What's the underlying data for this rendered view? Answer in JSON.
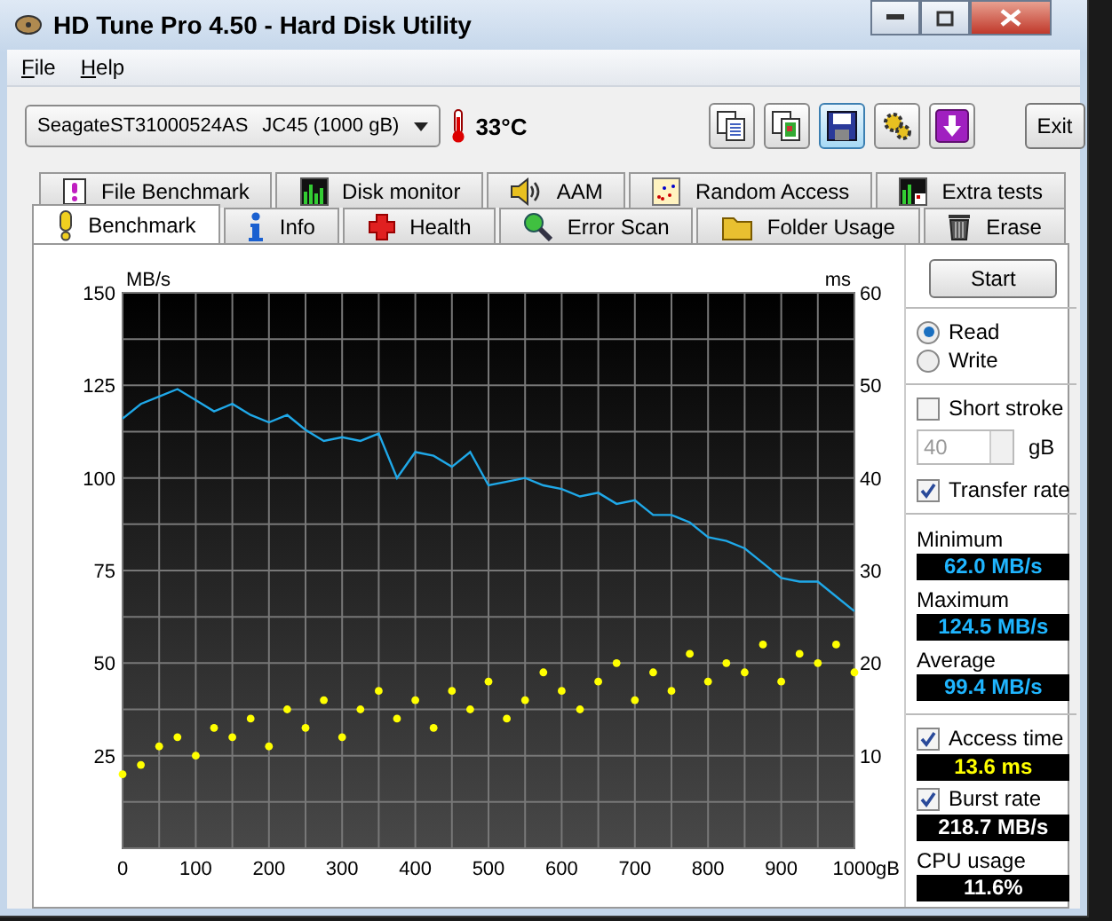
{
  "window": {
    "title": "HD Tune Pro 4.50 - Hard Disk Utility"
  },
  "menu": [
    {
      "label": "File"
    },
    {
      "label": "Help"
    }
  ],
  "toolbar": {
    "drive": {
      "model": "SeagateST31000524AS",
      "firmware": "JC45 (1000 gB)"
    },
    "temperature": "33°C",
    "buttons": [
      {
        "kind": "copy",
        "hovered": false
      },
      {
        "kind": "copy-color",
        "hovered": false
      },
      {
        "kind": "save",
        "hovered": true
      },
      {
        "kind": "options",
        "hovered": false
      },
      {
        "kind": "download",
        "hovered": false
      }
    ],
    "exit": "Exit"
  },
  "tabs": [
    [
      {
        "label": "File Benchmark",
        "kind": "file-benchmark",
        "selected": false
      },
      {
        "label": "Disk monitor",
        "kind": "disk-monitor",
        "selected": false
      },
      {
        "label": "AAM",
        "kind": "aam",
        "selected": false
      },
      {
        "label": "Random Access",
        "kind": "random-access",
        "selected": false
      },
      {
        "label": "Extra tests",
        "kind": "extra-tests",
        "selected": false
      }
    ],
    [
      {
        "label": "Benchmark",
        "kind": "benchmark",
        "selected": true
      },
      {
        "label": "Info",
        "kind": "info",
        "selected": false
      },
      {
        "label": "Health",
        "kind": "health",
        "selected": false
      },
      {
        "label": "Error Scan",
        "kind": "error-scan",
        "selected": false
      },
      {
        "label": "Folder Usage",
        "kind": "folder-usage",
        "selected": false
      },
      {
        "label": "Erase",
        "kind": "erase",
        "selected": false
      }
    ]
  ],
  "chart": {
    "chart_data": {
      "type": "line",
      "ylabel": "MB/s",
      "y2label": "ms",
      "xlim": [
        0,
        1000
      ],
      "ylim": [
        0,
        150
      ],
      "y2lim": [
        0,
        60
      ],
      "grid": true,
      "xlabel": "gB",
      "xticks": [
        0,
        100,
        200,
        300,
        400,
        500,
        600,
        700,
        800,
        900,
        1000
      ],
      "yticks": [
        25,
        50,
        75,
        100,
        125,
        150
      ],
      "y2ticks": [
        10,
        20,
        30,
        40,
        50,
        60
      ],
      "x": [
        0,
        25,
        50,
        75,
        100,
        125,
        150,
        175,
        200,
        225,
        250,
        275,
        300,
        325,
        350,
        375,
        400,
        425,
        450,
        475,
        500,
        525,
        550,
        575,
        600,
        625,
        650,
        675,
        700,
        725,
        750,
        775,
        800,
        825,
        850,
        875,
        900,
        925,
        950,
        975,
        1000
      ],
      "series": [
        {
          "color": "#1fa8e8",
          "values": [
            116,
            120,
            122,
            124,
            121,
            118,
            120,
            117,
            115,
            117,
            113,
            110,
            111,
            110,
            112,
            100,
            107,
            106,
            103,
            107,
            98,
            99,
            100,
            98,
            97,
            95,
            96,
            93,
            94,
            90,
            90,
            88,
            84,
            83,
            81,
            77,
            73,
            72,
            72,
            68,
            64
          ]
        },
        {
          "type": "scatter",
          "axis": "y2",
          "color": "#ffff00",
          "values": [
            8,
            9,
            11,
            12,
            10,
            13,
            12,
            14,
            11,
            15,
            13,
            16,
            12,
            15,
            17,
            14,
            16,
            13,
            17,
            15,
            18,
            14,
            16,
            19,
            17,
            15,
            18,
            20,
            16,
            19,
            17,
            21,
            18,
            20,
            19,
            22,
            18,
            21,
            20,
            22,
            19
          ]
        }
      ]
    }
  },
  "side_panel": {
    "start": "Start",
    "modes": [
      {
        "label": "Read",
        "selected": true
      },
      {
        "label": "Write",
        "selected": false
      }
    ],
    "short_stroke": {
      "label": "Short stroke",
      "checked": false,
      "value": "40",
      "unit": "gB",
      "disabled": true
    },
    "stats": [
      {
        "kind": "check",
        "label": "Transfer rate",
        "checked": true
      },
      {
        "kind": "divider"
      },
      {
        "kind": "label",
        "label": "Minimum"
      },
      {
        "kind": "rate",
        "value": "62.0 MB/s"
      },
      {
        "kind": "label",
        "label": "Maximum"
      },
      {
        "kind": "rate",
        "value": "124.5 MB/s"
      },
      {
        "kind": "label",
        "label": "Average"
      },
      {
        "kind": "rate",
        "value": "99.4 MB/s"
      },
      {
        "kind": "divider"
      },
      {
        "kind": "check",
        "label": "Access time",
        "checked": true
      },
      {
        "kind": "time",
        "value": "13.6 ms"
      },
      {
        "kind": "check",
        "label": "Burst rate",
        "checked": true
      },
      {
        "kind": "value",
        "value": "218.7 MB/s"
      },
      {
        "kind": "label",
        "label": "CPU usage"
      },
      {
        "kind": "value",
        "value": "11.6%"
      }
    ]
  }
}
